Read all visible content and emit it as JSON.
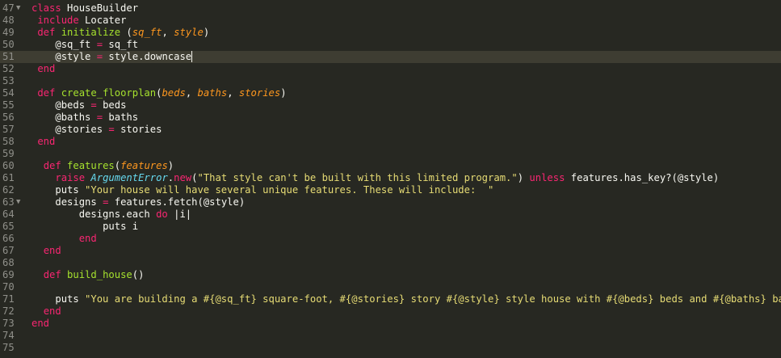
{
  "editor": {
    "active_line": 51,
    "lines": [
      {
        "n": "47",
        "fold": "▼",
        "indent": "",
        "tokens": [
          {
            "t": "class",
            "c": "kw"
          },
          {
            "t": " HouseBuilder",
            "c": "plain"
          }
        ]
      },
      {
        "n": "48",
        "fold": "",
        "indent": " ",
        "tokens": [
          {
            "t": "include",
            "c": "kw"
          },
          {
            "t": " Locater",
            "c": "plain"
          }
        ]
      },
      {
        "n": "49",
        "fold": "",
        "indent": " ",
        "tokens": [
          {
            "t": "def",
            "c": "kw"
          },
          {
            "t": " ",
            "c": "plain"
          },
          {
            "t": "initialize",
            "c": "fn"
          },
          {
            "t": " (",
            "c": "plain"
          },
          {
            "t": "sq_ft",
            "c": "param"
          },
          {
            "t": ", ",
            "c": "plain"
          },
          {
            "t": "style",
            "c": "param"
          },
          {
            "t": ")",
            "c": "plain"
          }
        ]
      },
      {
        "n": "50",
        "fold": "",
        "indent": "    ",
        "tokens": [
          {
            "t": "@sq_ft ",
            "c": "plain"
          },
          {
            "t": "=",
            "c": "kw"
          },
          {
            "t": " sq_ft",
            "c": "plain"
          }
        ]
      },
      {
        "n": "51",
        "fold": "",
        "indent": "    ",
        "tokens": [
          {
            "t": "@style ",
            "c": "plain"
          },
          {
            "t": "=",
            "c": "kw"
          },
          {
            "t": " style.downcase",
            "c": "plain"
          }
        ]
      },
      {
        "n": "52",
        "fold": "",
        "indent": " ",
        "tokens": [
          {
            "t": "end",
            "c": "kw"
          }
        ]
      },
      {
        "n": "53",
        "fold": "",
        "indent": "",
        "tokens": []
      },
      {
        "n": "54",
        "fold": "",
        "indent": " ",
        "tokens": [
          {
            "t": "def",
            "c": "kw"
          },
          {
            "t": " ",
            "c": "plain"
          },
          {
            "t": "create_floorplan",
            "c": "fn"
          },
          {
            "t": "(",
            "c": "plain"
          },
          {
            "t": "beds",
            "c": "param"
          },
          {
            "t": ", ",
            "c": "plain"
          },
          {
            "t": "baths",
            "c": "param"
          },
          {
            "t": ", ",
            "c": "plain"
          },
          {
            "t": "stories",
            "c": "param"
          },
          {
            "t": ")",
            "c": "plain"
          }
        ]
      },
      {
        "n": "55",
        "fold": "",
        "indent": "    ",
        "tokens": [
          {
            "t": "@beds ",
            "c": "plain"
          },
          {
            "t": "=",
            "c": "kw"
          },
          {
            "t": " beds",
            "c": "plain"
          }
        ]
      },
      {
        "n": "56",
        "fold": "",
        "indent": "    ",
        "tokens": [
          {
            "t": "@baths ",
            "c": "plain"
          },
          {
            "t": "=",
            "c": "kw"
          },
          {
            "t": " baths",
            "c": "plain"
          }
        ]
      },
      {
        "n": "57",
        "fold": "",
        "indent": "    ",
        "tokens": [
          {
            "t": "@stories ",
            "c": "plain"
          },
          {
            "t": "=",
            "c": "kw"
          },
          {
            "t": " stories",
            "c": "plain"
          }
        ]
      },
      {
        "n": "58",
        "fold": "",
        "indent": " ",
        "tokens": [
          {
            "t": "end",
            "c": "kw"
          }
        ]
      },
      {
        "n": "59",
        "fold": "",
        "indent": "",
        "tokens": []
      },
      {
        "n": "60",
        "fold": "",
        "indent": "  ",
        "tokens": [
          {
            "t": "def",
            "c": "kw"
          },
          {
            "t": " ",
            "c": "plain"
          },
          {
            "t": "features",
            "c": "fn"
          },
          {
            "t": "(",
            "c": "plain"
          },
          {
            "t": "features",
            "c": "param"
          },
          {
            "t": ")",
            "c": "plain"
          }
        ]
      },
      {
        "n": "61",
        "fold": "",
        "indent": "    ",
        "tokens": [
          {
            "t": "raise",
            "c": "kw"
          },
          {
            "t": " ",
            "c": "plain"
          },
          {
            "t": "ArgumentError",
            "c": "cls"
          },
          {
            "t": ".",
            "c": "plain"
          },
          {
            "t": "new",
            "c": "kw"
          },
          {
            "t": "(",
            "c": "plain"
          },
          {
            "t": "\"That style can't be built with this limited program.\"",
            "c": "str"
          },
          {
            "t": ") ",
            "c": "plain"
          },
          {
            "t": "unless",
            "c": "kw"
          },
          {
            "t": " features.has_key?(@style)",
            "c": "plain"
          }
        ]
      },
      {
        "n": "62",
        "fold": "",
        "indent": "    ",
        "tokens": [
          {
            "t": "puts ",
            "c": "plain"
          },
          {
            "t": "\"Your house will have several unique features. These will include:  \"",
            "c": "str"
          }
        ]
      },
      {
        "n": "63",
        "fold": "▼",
        "indent": "    ",
        "tokens": [
          {
            "t": "designs ",
            "c": "plain"
          },
          {
            "t": "=",
            "c": "kw"
          },
          {
            "t": " features.fetch(@style)",
            "c": "plain"
          }
        ]
      },
      {
        "n": "64",
        "fold": "",
        "indent": "        ",
        "tokens": [
          {
            "t": "designs.each ",
            "c": "plain"
          },
          {
            "t": "do",
            "c": "kw"
          },
          {
            "t": " |i|",
            "c": "plain"
          }
        ]
      },
      {
        "n": "65",
        "fold": "",
        "indent": "            ",
        "tokens": [
          {
            "t": "puts i",
            "c": "plain"
          }
        ]
      },
      {
        "n": "66",
        "fold": "",
        "indent": "        ",
        "tokens": [
          {
            "t": "end",
            "c": "kw"
          }
        ]
      },
      {
        "n": "67",
        "fold": "",
        "indent": "  ",
        "tokens": [
          {
            "t": "end",
            "c": "kw"
          }
        ]
      },
      {
        "n": "68",
        "fold": "",
        "indent": "",
        "tokens": []
      },
      {
        "n": "69",
        "fold": "",
        "indent": "  ",
        "tokens": [
          {
            "t": "def",
            "c": "kw"
          },
          {
            "t": " ",
            "c": "plain"
          },
          {
            "t": "build_house",
            "c": "fn"
          },
          {
            "t": "()",
            "c": "plain"
          }
        ]
      },
      {
        "n": "70",
        "fold": "",
        "indent": "",
        "tokens": []
      },
      {
        "n": "71",
        "fold": "",
        "indent": "    ",
        "tokens": [
          {
            "t": "puts ",
            "c": "plain"
          },
          {
            "t": "\"You are building a #{@sq_ft} square-foot, #{@stories} story #{@style} style house with #{@beds} beds and #{@baths} baths.\"",
            "c": "str"
          }
        ]
      },
      {
        "n": "72",
        "fold": "",
        "indent": "  ",
        "tokens": [
          {
            "t": "end",
            "c": "kw"
          }
        ]
      },
      {
        "n": "73",
        "fold": "",
        "indent": "",
        "tokens": [
          {
            "t": "end",
            "c": "kw"
          }
        ]
      },
      {
        "n": "74",
        "fold": "",
        "indent": "",
        "tokens": []
      },
      {
        "n": "75",
        "fold": "",
        "indent": "",
        "tokens": []
      }
    ]
  },
  "colors": {
    "background": "#272822",
    "keyword": "#f92672",
    "function": "#a6e22e",
    "parameter": "#fd971f",
    "class": "#66d9ef",
    "string": "#e6db74",
    "text": "#f8f8f2",
    "line_number": "#90908a"
  }
}
